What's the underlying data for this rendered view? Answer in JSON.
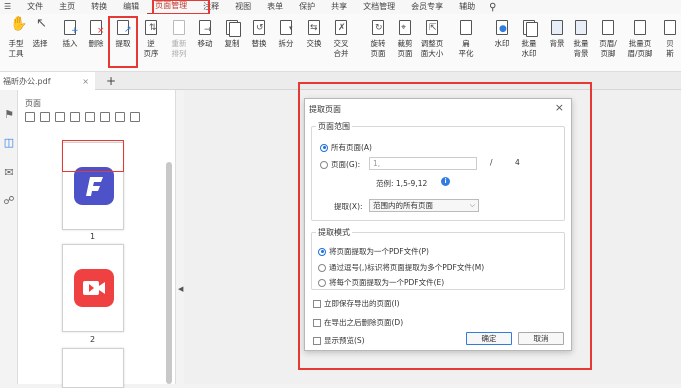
{
  "menubar": {
    "items": [
      "文件",
      "主页",
      "转换",
      "编辑",
      "页面管理",
      "注释",
      "视图",
      "表单",
      "保护",
      "共享",
      "文档管理",
      "会员专享",
      "辅助"
    ],
    "active_index": 4
  },
  "toolbar": {
    "hand": "手型工具",
    "select": "选择",
    "insert": "插入",
    "delete": "删除",
    "extract": "提取",
    "reverse_1": "逆",
    "reverse_2": "页序",
    "renumber_1": "重新",
    "renumber_2": "排列",
    "move": "移动",
    "copy": "复制",
    "replace": "替换",
    "split": "拆分",
    "swap": "交换",
    "merge_1": "交叉",
    "merge_2": "合并",
    "rotate_1": "旋转",
    "rotate_2": "页面",
    "crop_1": "裁剪",
    "crop_2": "页面",
    "resize_1": "调整页",
    "resize_2": "面大小",
    "flatten_1": "扁",
    "flatten_2": "平化",
    "watermark": "水印",
    "batch_wm_1": "批量",
    "batch_wm_2": "水印",
    "background": "背景",
    "batch_bg_1": "批量",
    "batch_bg_2": "背景",
    "header_1": "页眉/",
    "header_2": "页脚",
    "batch_hf_1": "批量页",
    "batch_hf_2": "眉/页脚",
    "bates_1": "贝",
    "bates_2": "斯"
  },
  "tab": {
    "name": "福昕办公.pdf",
    "close": "×",
    "add": "+"
  },
  "panel": {
    "title": "页面",
    "page1": "1",
    "page2": "2"
  },
  "dialog": {
    "title": "提取页面",
    "close": "×",
    "range_title": "页面范围",
    "all_pages": "所有页面(A)",
    "pages": "页面(G):",
    "pages_placeholder": "1,",
    "slash": "/",
    "total": "4",
    "example": "范例: 1,5-9,12",
    "info": "i",
    "extract_label": "提取(X):",
    "extract_value": "范围内的所有页面",
    "mode_title": "提取模式",
    "mode1": "将页面提取为一个PDF文件(P)",
    "mode2": "通过逗号(,)标识将页面提取为多个PDF文件(M)",
    "mode3": "将每个页面提取为一个PDF文件(E)",
    "chk1": "立即保存导出的页面(I)",
    "chk2": "在导出之后删除页面(D)",
    "chk3": "显示预览(S)",
    "ok": "确定",
    "cancel": "取消"
  },
  "colors": {
    "accent": "#c0392b",
    "highlight": "#e53935",
    "radio": "#1e6fd9",
    "app1": "#4d52c8",
    "app2": "#ef4141"
  }
}
